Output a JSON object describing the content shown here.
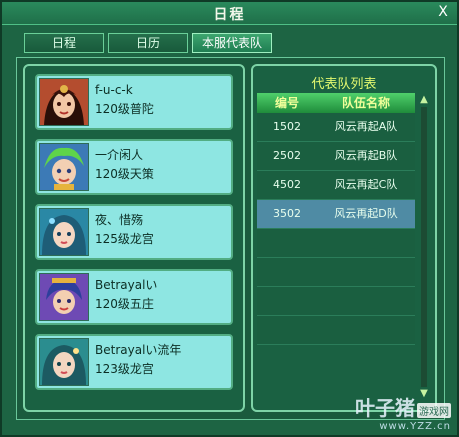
{
  "window": {
    "title": "日程",
    "close_label": "X"
  },
  "tabs": [
    {
      "label": "日程"
    },
    {
      "label": "日历"
    },
    {
      "label": "本服代表队"
    }
  ],
  "characters": [
    {
      "name": "f-u-c-k",
      "level_class": "120级普陀"
    },
    {
      "name": "一介闲人",
      "level_class": "120级天策"
    },
    {
      "name": "夜、惜殇",
      "level_class": "125级龙宫"
    },
    {
      "name": "Betrayalい",
      "level_class": "120级五庄"
    },
    {
      "name": "Betrayalい流年",
      "level_class": "123级龙宫"
    }
  ],
  "team_list": {
    "title": "代表队列表",
    "headers": {
      "id": "编号",
      "name": "队伍名称"
    },
    "rows": [
      {
        "id": "1502",
        "name": "风云再起A队"
      },
      {
        "id": "2502",
        "name": "风云再起B队"
      },
      {
        "id": "4502",
        "name": "风云再起C队"
      },
      {
        "id": "3502",
        "name": "风云再起D队"
      }
    ]
  },
  "watermark": {
    "brand": "叶子猪",
    "badge": "游戏网",
    "url": "www.YZZ.cn"
  }
}
